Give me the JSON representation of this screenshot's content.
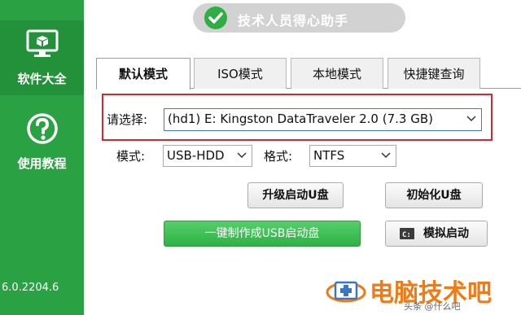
{
  "sidebar": {
    "items": [
      {
        "label": "软件大全",
        "icon": "monitor-icon"
      },
      {
        "label": "使用教程",
        "icon": "question-icon"
      }
    ],
    "version": "6.0.2204.6"
  },
  "header": {
    "title": "技术人员得心助手",
    "icon": "check-circle-icon"
  },
  "tabs": [
    {
      "label": "默认模式",
      "active": true
    },
    {
      "label": "ISO模式",
      "active": false
    },
    {
      "label": "本地模式",
      "active": false
    },
    {
      "label": "快捷键查询",
      "active": false
    }
  ],
  "form": {
    "select_label": "请选择:",
    "device_value": "(hd1) E: Kingston DataTraveler 2.0 (7.3 GB)",
    "mode_label": "模式:",
    "mode_value": "USB-HDD",
    "format_label": "格式:",
    "format_value": "NTFS"
  },
  "buttons": {
    "upgrade": "升级启动U盘",
    "init": "初始化U盘",
    "make": "一键制作成USB启动盘",
    "simulate": "模拟启动"
  },
  "colors": {
    "sidebar": "#2aa142",
    "highlight_box": "#d9252f",
    "primary_button": "#3cbf55",
    "watermark": "#f07a16"
  },
  "watermark": {
    "text": "电脑技术吧",
    "sub": "头条 @什么吧"
  }
}
